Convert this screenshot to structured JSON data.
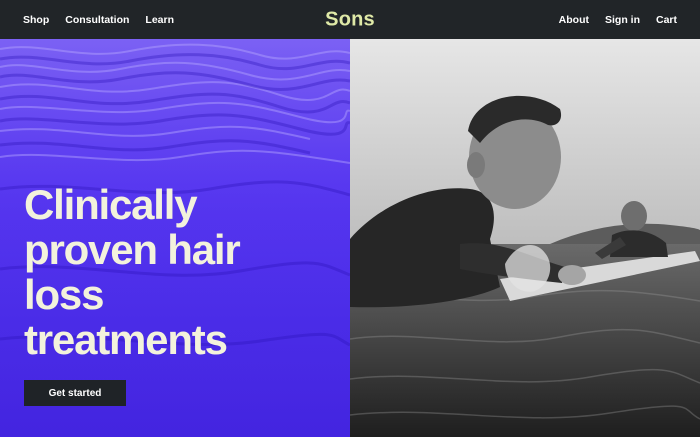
{
  "nav": {
    "left_links": [
      {
        "label": "Shop"
      },
      {
        "label": "Consultation"
      },
      {
        "label": "Learn"
      }
    ],
    "brand": "Sons",
    "right_links": [
      {
        "label": "About"
      },
      {
        "label": "Sign in"
      },
      {
        "label": "Cart"
      }
    ]
  },
  "hero": {
    "title_lines": [
      "Clinically",
      "proven hair",
      "loss",
      "treatments"
    ],
    "cta_label": "Get started"
  },
  "colors": {
    "nav_bg": "#212528",
    "brand": "#dfe9a7",
    "hero_purple": "#5636f0",
    "hero_text": "#f3f2dc",
    "cta_bg": "#1f2327"
  }
}
